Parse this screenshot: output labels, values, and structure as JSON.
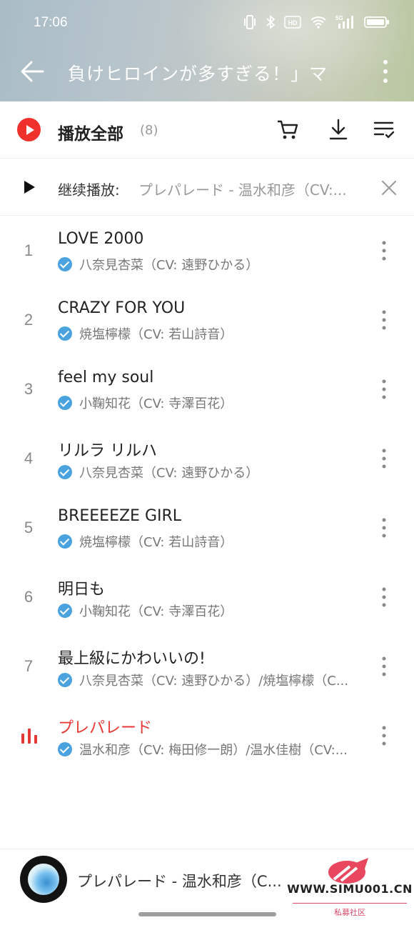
{
  "status_bar": {
    "time": "17:06",
    "hd_label": "HD",
    "network_label": "5G"
  },
  "header": {
    "title": "負けヒロインが多すぎる！」マ"
  },
  "play_all": {
    "label": "播放全部",
    "count": "(8)"
  },
  "resume": {
    "label": "继续播放:",
    "track": "プレパレード - 温水和彦（CV:..."
  },
  "tracks": [
    {
      "num": "1",
      "title": "LOVE 2000",
      "artist": "八奈見杏菜（CV: 遠野ひかる）"
    },
    {
      "num": "2",
      "title": "CRAZY FOR YOU",
      "artist": "焼塩檸檬（CV: 若山詩音）"
    },
    {
      "num": "3",
      "title": "feel my soul",
      "artist": "小鞠知花（CV: 寺澤百花）"
    },
    {
      "num": "4",
      "title": "リルラ リルハ",
      "artist": "八奈見杏菜（CV: 遠野ひかる）"
    },
    {
      "num": "5",
      "title": "BREEEEZE GIRL",
      "artist": "焼塩檸檬（CV: 若山詩音）"
    },
    {
      "num": "6",
      "title": "明日も",
      "artist": "小鞠知花（CV: 寺澤百花）"
    },
    {
      "num": "7",
      "title": "最上級にかわいいの!",
      "artist": "八奈見杏菜（CV: 遠野ひかる）/焼塩檸檬（C..."
    },
    {
      "num": "",
      "title": "プレパレード",
      "artist": "温水和彦（CV: 梅田修一朗）/温水佳樹（CV:..."
    }
  ],
  "mini_player": {
    "title": "プレパレード - 温水和彦（C..."
  },
  "watermark": {
    "site": "WWW.SIMU001.CN",
    "sub": "私募社区"
  },
  "colors": {
    "accent": "#f0302b",
    "active_track": "#e53935",
    "verified": "#4aa3df"
  },
  "icons": {
    "back": "arrow-left-icon",
    "more": "more-vertical-icon",
    "cart": "cart-icon",
    "download": "download-icon",
    "multi_select": "list-check-icon",
    "close": "close-icon",
    "playing": "equalizer-icon"
  }
}
